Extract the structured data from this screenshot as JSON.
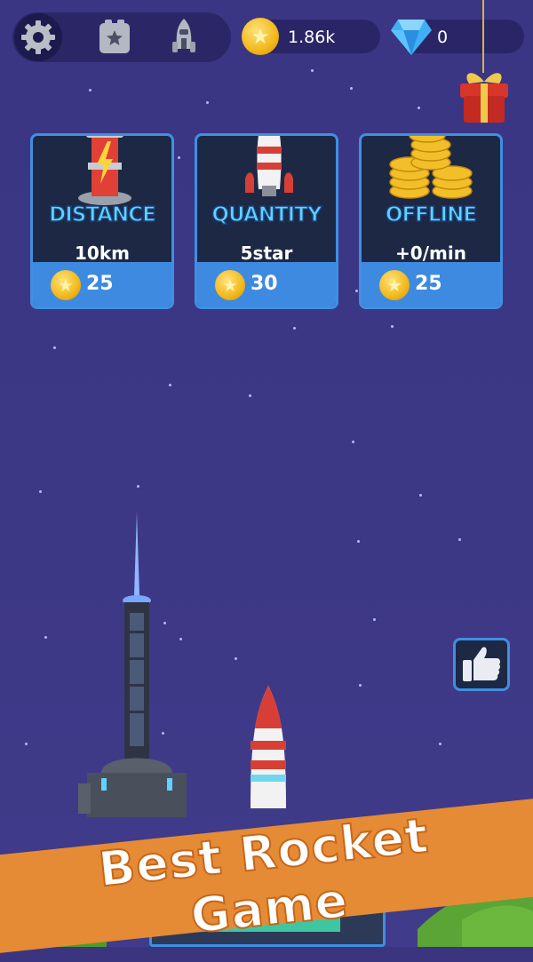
{
  "topbar": {
    "settings_icon": "gear-icon",
    "missions_icon": "star-box-icon",
    "rocket_icon": "rocket-icon"
  },
  "currency": {
    "coins": "1.86k",
    "gems": "0"
  },
  "cards": [
    {
      "title": "DISTANCE",
      "value": "10km",
      "cost": "25",
      "icon": "battery-tower-icon"
    },
    {
      "title": "QUANTITY",
      "value": "5star",
      "cost": "30",
      "icon": "rocket-icon"
    },
    {
      "title": "OFFLINE",
      "value": "+0/min",
      "cost": "25",
      "icon": "coin-stack-icon"
    }
  ],
  "banner": {
    "text": "Best Rocket Game"
  },
  "colors": {
    "sky": "#3b3580",
    "card_bg": "#1d2844",
    "card_accent": "#3e8ae0",
    "title_text": "#5dd3ff",
    "banner": "#e58b35"
  }
}
